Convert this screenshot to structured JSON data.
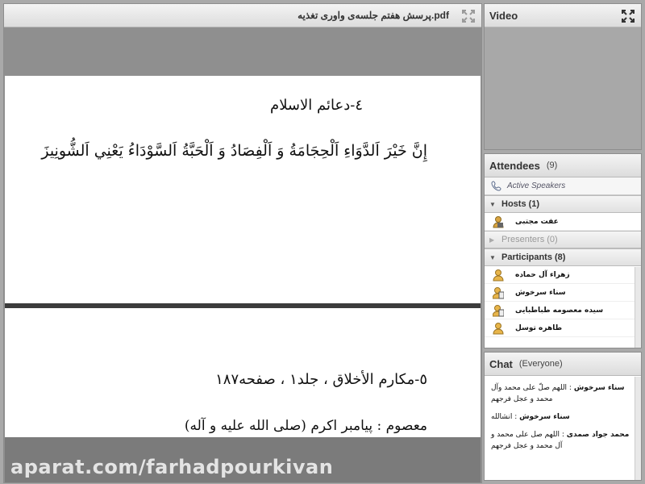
{
  "share": {
    "title": "پرسش هفتم جلسه‌ی واوری ‌تغذیه.pdf",
    "page1": {
      "heading": "٤-دعائم الاسلام",
      "verse": "إِنَّ خَيْرَ اَلدَّوَاءِ اَلْحِجَامَةُ وَ اَلْفِصَادُ وَ اَلْحَبَّةُ اَلسَّوْدَاءُ يَعْنِي اَلشُّونِيزَ"
    },
    "page2": {
      "heading": "٥-مكارم الأخلاق ، جلد١ ، صفحه١٨٧",
      "sub": "معصوم : پیامبر اکرم (صلى الله عليه و آله)"
    },
    "watermark": "aparat.com/farhadpourkivan"
  },
  "video": {
    "title": "Video"
  },
  "attendees": {
    "title": "Attendees",
    "count": "(9)",
    "active_speakers": "Active Speakers",
    "hosts": {
      "label": "Hosts (1)",
      "items": [
        "عفت مجتبی"
      ]
    },
    "presenters": {
      "label": "Presenters (0)"
    },
    "participants": {
      "label": "Participants (8)",
      "items": [
        "زهراء آل حماده",
        "سناء سرخوش",
        "سیده معصومه طباطبایی",
        "طاهره توسل"
      ]
    }
  },
  "chat": {
    "title": "Chat",
    "scope": "(Everyone)",
    "messages": [
      {
        "sender": "سناء سرخوش",
        "text": "اللهم صلّ علی محمد وآل محمد و عجل فرجهم"
      },
      {
        "sender": "سناء سرخوش",
        "text": "انشالله"
      },
      {
        "sender": "محمد جواد صمدی",
        "text": "اللهم صل علی محمد و آل محمد و عجل فرجهم"
      }
    ]
  },
  "colors": {
    "pod_header": "#e4e4e4",
    "stage_gray": "#8f8f8f",
    "divider": "#3c3c3c"
  }
}
